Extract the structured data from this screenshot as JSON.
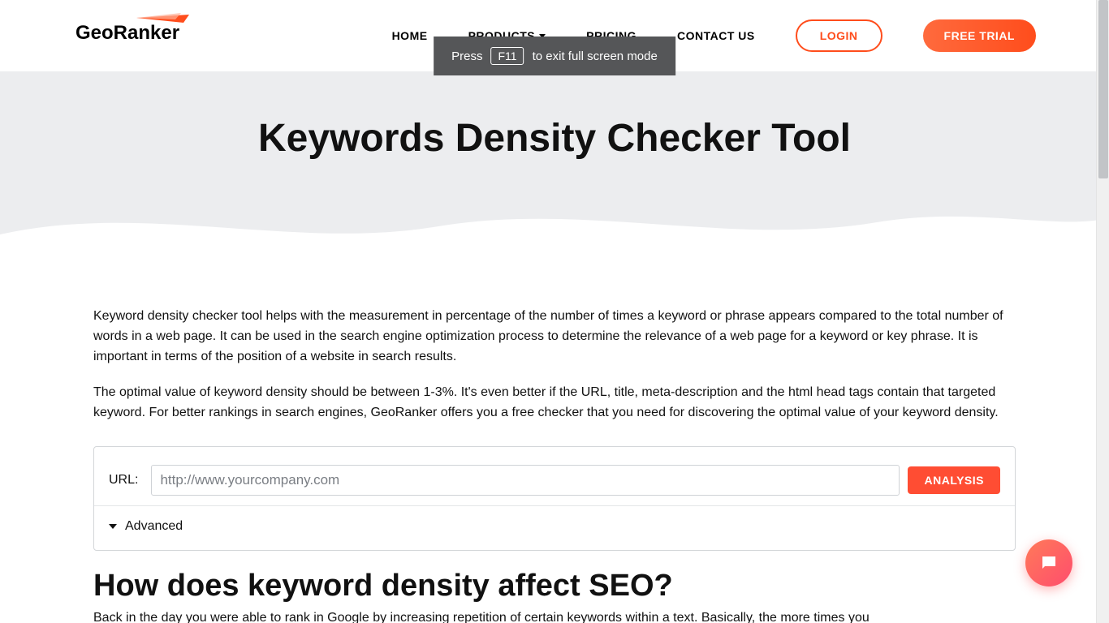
{
  "header": {
    "logo_text": "GeoRanker",
    "nav": {
      "home": "HOME",
      "products": "PRODUCTS",
      "pricing": "PRICING",
      "contact": "CONTACT US"
    },
    "login_label": "LOGIN",
    "trial_label": "FREE TRIAL"
  },
  "hero": {
    "title": "Keywords Density Checker Tool"
  },
  "content": {
    "para1": "Keyword density checker tool helps with the measurement in percentage of the number of times a keyword or phrase appears compared to the total number of words in a web page. It can be used in the search engine optimization process to determine the relevance of a web page for a keyword or key phrase. It is important in terms of the position of a website in search results.",
    "para2": "The optimal value of keyword density should be between 1-3%. It's even better if the URL, title, meta-description and the html head tags contain that targeted keyword. For better rankings in search engines, GeoRanker offers you a free checker that you need for discovering the optimal value of your keyword density."
  },
  "form": {
    "url_label": "URL:",
    "url_placeholder": "http://www.yourcompany.com",
    "analysis_label": "ANALYSIS",
    "advanced_label": "Advanced"
  },
  "section2": {
    "heading": "How does keyword density affect SEO?",
    "para": "Back in the day you were able to rank in Google by increasing repetition of certain keywords within a text. Basically, the more times you"
  },
  "toast": {
    "pre": "Press",
    "key": "F11",
    "post": "to exit full screen mode"
  }
}
